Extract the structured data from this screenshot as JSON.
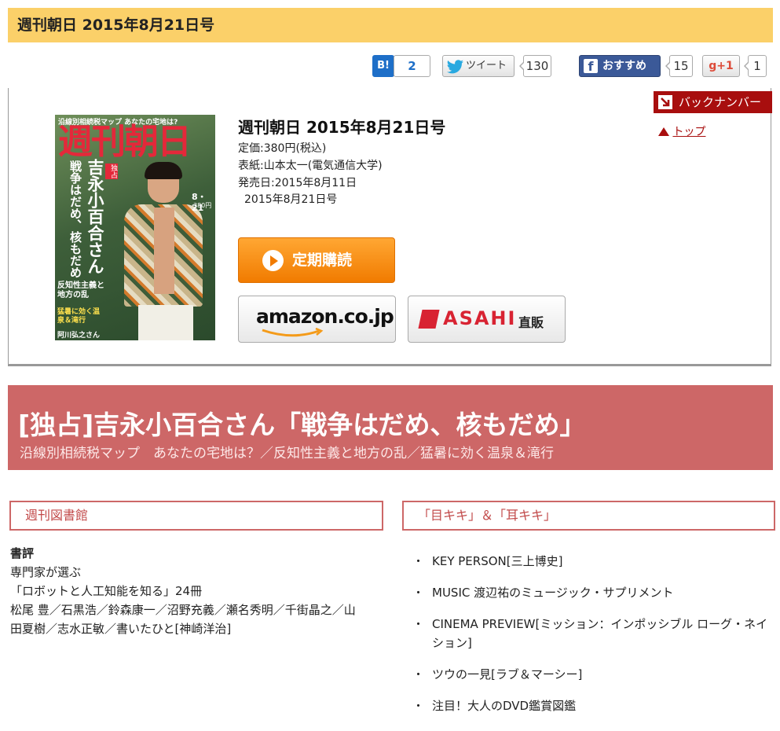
{
  "header": {
    "title": "週刊朝日 2015年8月21日号"
  },
  "share": {
    "hatena_label": "B!",
    "hatena_count": "2",
    "tweet_label": "ツイート",
    "tweet_count": "130",
    "fb_label": "おすすめ",
    "fb_count": "15",
    "gplus_label": "g+1",
    "gplus_count": "1"
  },
  "cover": {
    "masthead": "週刊朝日",
    "top_text": "沿線別相続税マップ あなたの宅地は?",
    "headline": "吉永小百合さん",
    "quote": "戦争はだめ、核もだめ",
    "badge": "独占",
    "date": "8・21",
    "price": "380円",
    "side1": "反知性主義と地方の乱",
    "side2": "猛暑に効く温泉＆滝行",
    "bottom": "阿川弘之さん"
  },
  "issue": {
    "title": "週刊朝日 2015年8月21日号",
    "price": "定価:380円(税込)",
    "cover_credit": "表紙:山本太一(電気通信大学)",
    "release": "発売日:2015年8月11日",
    "issue_date": "2015年8月21日号"
  },
  "buttons": {
    "subscribe": "定期購読",
    "amazon": "amazon.co.jp",
    "asahi": "ASAHI",
    "asahi_suffix": "直販"
  },
  "nav": {
    "backnumber": "バックナンバー",
    "top": "トップ"
  },
  "feature": {
    "title": "[独占]吉永小百合さん「戦争はだめ、核もだめ」",
    "subtitle": "沿線別相続税マップ　あなたの宅地は？／反知性主義と地方の乱／猛暑に効く温泉＆滝行"
  },
  "library": {
    "heading": "週刊図書館",
    "review_label": "書評",
    "line1": "専門家が選ぶ",
    "line2": "「ロボットと人工知能を知る」24冊",
    "line3": "松尾 豊／石黒浩／鈴森康一／沼野充義／瀬名秀明／千街晶之／山",
    "line4": "田夏樹／志水正敏／書いたひと[神崎洋治]"
  },
  "culture": {
    "heading": "「目キキ」＆「耳キキ」",
    "items": [
      "KEY PERSON[三上博史]",
      "MUSIC 渡辺祐のミュージック・サプリメント",
      "CINEMA PREVIEW[ミッション：インポッシブル ローグ・ネイション]",
      "ツウの一見[ラブ＆マーシー]",
      "注目！大人のDVD鑑賞図鑑"
    ]
  }
}
